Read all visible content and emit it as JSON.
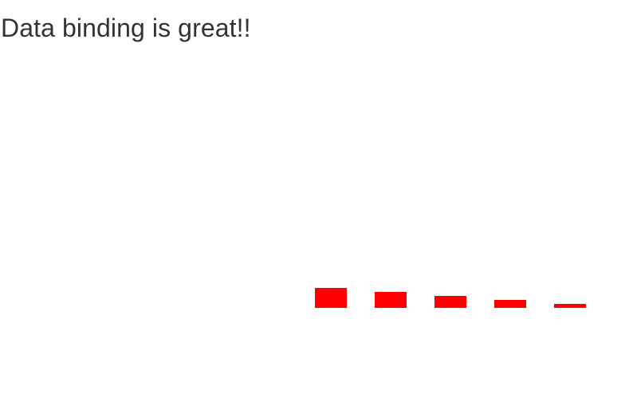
{
  "page": {
    "heading": "Data binding is great!!"
  },
  "colors": {
    "bar": "#ff0000",
    "heading": "#333333",
    "background": "#ffffff"
  },
  "chart_data": {
    "type": "bar",
    "values": [
      5,
      4,
      3,
      2,
      1
    ],
    "color": "#ff0000"
  }
}
